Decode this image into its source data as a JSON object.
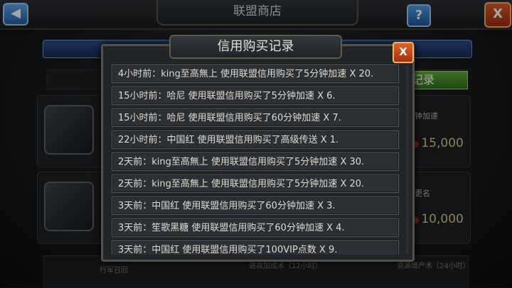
{
  "header": {
    "title": "联盟商店",
    "back_icon": "◀",
    "help_label": "?",
    "close_label": "X"
  },
  "background": {
    "record_button": "记录",
    "item1_label": "钟加速",
    "item1_price": "15,000",
    "item2_label": "更名",
    "item2_price": "10,000",
    "bottom1": "行军召回",
    "bottom2": "进攻加成术（12小时）",
    "bottom3": "资源增产术（24小时）"
  },
  "dialog": {
    "title": "信用购买记录",
    "close_label": "X",
    "rows": [
      "4小时前：king至高無上 使用联盟信用购买了5分钟加速 X 20.",
      "15小时前：哈尼 使用联盟信用购买了5分钟加速 X 6.",
      "15小时前：哈尼 使用联盟信用购买了60分钟加速 X 7.",
      "22小时前：中国红 使用联盟信用购买了高级传送 X 1.",
      "2天前：king至高無上 使用联盟信用购买了5分钟加速 X 30.",
      "2天前：king至高無上 使用联盟信用购买了5分钟加速 X 20.",
      "3天前：中国红 使用联盟信用购买了60分钟加速 X 3.",
      "3天前：笙歌黑糖 使用联盟信用购买了60分钟加速 X 4.",
      "3天前：中国红 使用联盟信用购买了100VIP点数 X 9."
    ]
  }
}
